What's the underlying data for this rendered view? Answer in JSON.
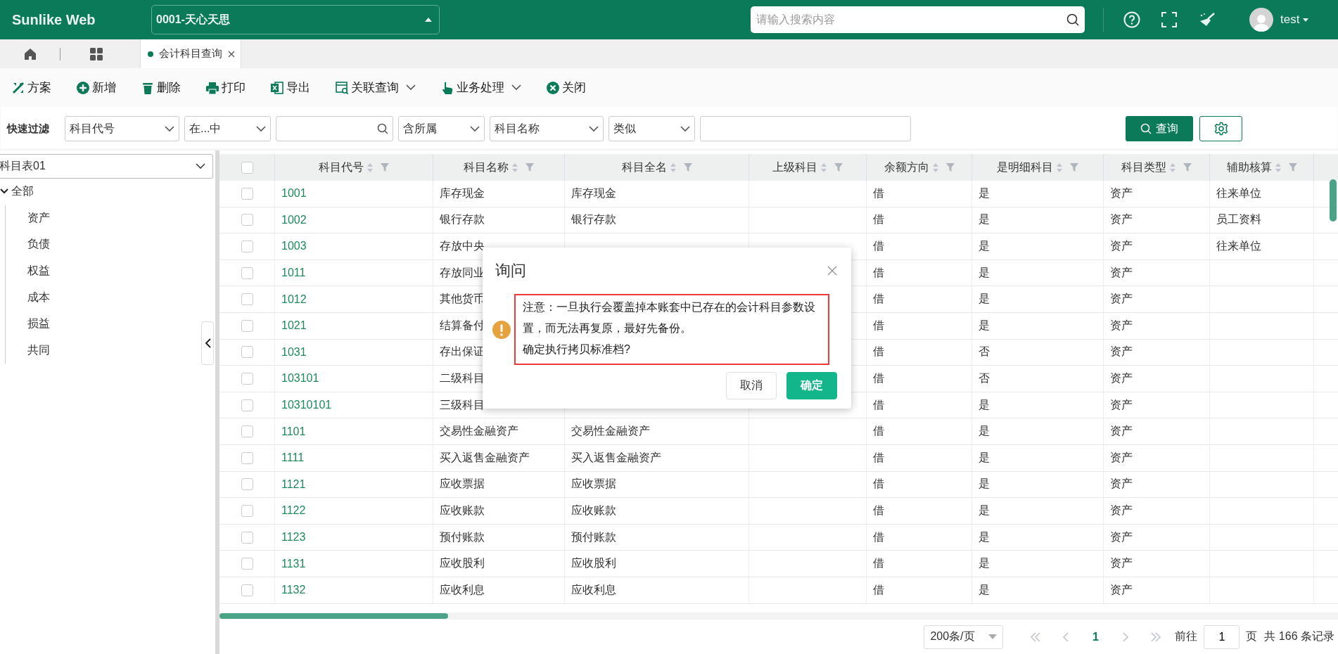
{
  "header": {
    "logo": "Sunlike Web",
    "company": "0001-天心天思",
    "search_placeholder": "请输入搜索内容",
    "user": "test"
  },
  "tabs": [
    {
      "label": "会计科目查询",
      "selected": true
    }
  ],
  "toolbar": [
    {
      "kind": "scheme",
      "label": "方案",
      "dropdown": false
    },
    {
      "kind": "add",
      "label": "新增",
      "dropdown": false
    },
    {
      "kind": "delete",
      "label": "删除",
      "dropdown": false
    },
    {
      "kind": "print",
      "label": "打印",
      "dropdown": false
    },
    {
      "kind": "export",
      "label": "导出",
      "dropdown": false
    },
    {
      "kind": "query",
      "label": "关联查询",
      "dropdown": true
    },
    {
      "kind": "process",
      "label": "业务处理",
      "dropdown": true
    },
    {
      "kind": "close",
      "label": "关闭",
      "dropdown": false
    }
  ],
  "filter": {
    "label": "快速过滤",
    "fields": [
      {
        "kind": "select",
        "value": "科目代号"
      },
      {
        "kind": "select",
        "value": "在...中"
      },
      {
        "kind": "search"
      },
      {
        "kind": "select",
        "value": "含所属"
      },
      {
        "kind": "select",
        "value": "科目名称"
      },
      {
        "kind": "select",
        "value": "类似"
      },
      {
        "kind": "input"
      }
    ],
    "query_button": "查询"
  },
  "sidebar": {
    "chart_select": "科目表01",
    "tree": [
      {
        "label": "全部",
        "expanded": true,
        "children": [
          {
            "label": "资产"
          },
          {
            "label": "负债"
          },
          {
            "label": "权益"
          },
          {
            "label": "成本"
          },
          {
            "label": "损益"
          },
          {
            "label": "共同"
          }
        ]
      }
    ]
  },
  "table": {
    "all_checked": false,
    "columns": [
      "科目代号",
      "科目名称",
      "科目全名",
      "上级科目",
      "余额方向",
      "是明细科目",
      "科目类型",
      "辅助核算"
    ],
    "rows": [
      {
        "checked": false,
        "code": "1001",
        "name": "库存现金",
        "full_name": "库存现金",
        "balance": "借",
        "detail": "是",
        "type": "资产",
        "auxiliary": "往来单位"
      },
      {
        "checked": false,
        "code": "1002",
        "name": "银行存款",
        "full_name": "银行存款",
        "balance": "借",
        "detail": "是",
        "type": "资产",
        "auxiliary": "员工资料"
      },
      {
        "checked": false,
        "code": "1003",
        "name": "存放中央",
        "balance": "借",
        "detail": "是",
        "type": "资产",
        "auxiliary": "往来单位"
      },
      {
        "checked": false,
        "code": "1011",
        "name": "存放同业",
        "balance": "借",
        "detail": "是",
        "type": "资产"
      },
      {
        "checked": false,
        "code": "1012",
        "name": "其他货币",
        "balance": "借",
        "detail": "是",
        "type": "资产"
      },
      {
        "checked": false,
        "code": "1021",
        "name": "结算备付",
        "balance": "借",
        "detail": "是",
        "type": "资产"
      },
      {
        "checked": false,
        "code": "1031",
        "name": "存出保证",
        "balance": "借",
        "detail": "否",
        "type": "资产"
      },
      {
        "checked": false,
        "code": "103101",
        "name": "二级科目",
        "balance": "借",
        "detail": "否",
        "type": "资产"
      },
      {
        "checked": false,
        "code": "10310101",
        "name": "三级科目",
        "balance": "借",
        "detail": "是",
        "type": "资产"
      },
      {
        "checked": false,
        "code": "1101",
        "name": "交易性金融资产",
        "full_name": "交易性金融资产",
        "balance": "借",
        "detail": "是",
        "type": "资产"
      },
      {
        "checked": false,
        "code": "1111",
        "name": "买入返售金融资产",
        "full_name": "买入返售金融资产",
        "balance": "借",
        "detail": "是",
        "type": "资产"
      },
      {
        "checked": false,
        "code": "1121",
        "name": "应收票据",
        "full_name": "应收票据",
        "balance": "借",
        "detail": "是",
        "type": "资产"
      },
      {
        "checked": false,
        "code": "1122",
        "name": "应收账款",
        "full_name": "应收账款",
        "balance": "借",
        "detail": "是",
        "type": "资产"
      },
      {
        "checked": false,
        "code": "1123",
        "name": "预付账款",
        "full_name": "预付账款",
        "balance": "借",
        "detail": "是",
        "type": "资产"
      },
      {
        "checked": false,
        "code": "1131",
        "name": "应收股利",
        "full_name": "应收股利",
        "balance": "借",
        "detail": "是",
        "type": "资产"
      },
      {
        "checked": false,
        "code": "1132",
        "name": "应收利息",
        "full_name": "应收利息",
        "balance": "借",
        "detail": "是",
        "type": "资产"
      }
    ]
  },
  "pagination": {
    "page_size": "200条/页",
    "pages": [
      {
        "label": "1",
        "selected": true
      }
    ],
    "goto_label": "前往",
    "goto_value": "1",
    "page_unit": "页",
    "total": "共 166 条记录"
  },
  "dialog": {
    "title": "询问",
    "message": [
      "注意：一旦执行会覆盖掉本账套中已存在的会计科目参数设置，而无法再复原，最好先备份。",
      "确定执行拷贝标准档?"
    ],
    "buttons": [
      {
        "kind": "secondary",
        "label": "取消"
      },
      {
        "kind": "primary",
        "label": "确定"
      }
    ]
  }
}
